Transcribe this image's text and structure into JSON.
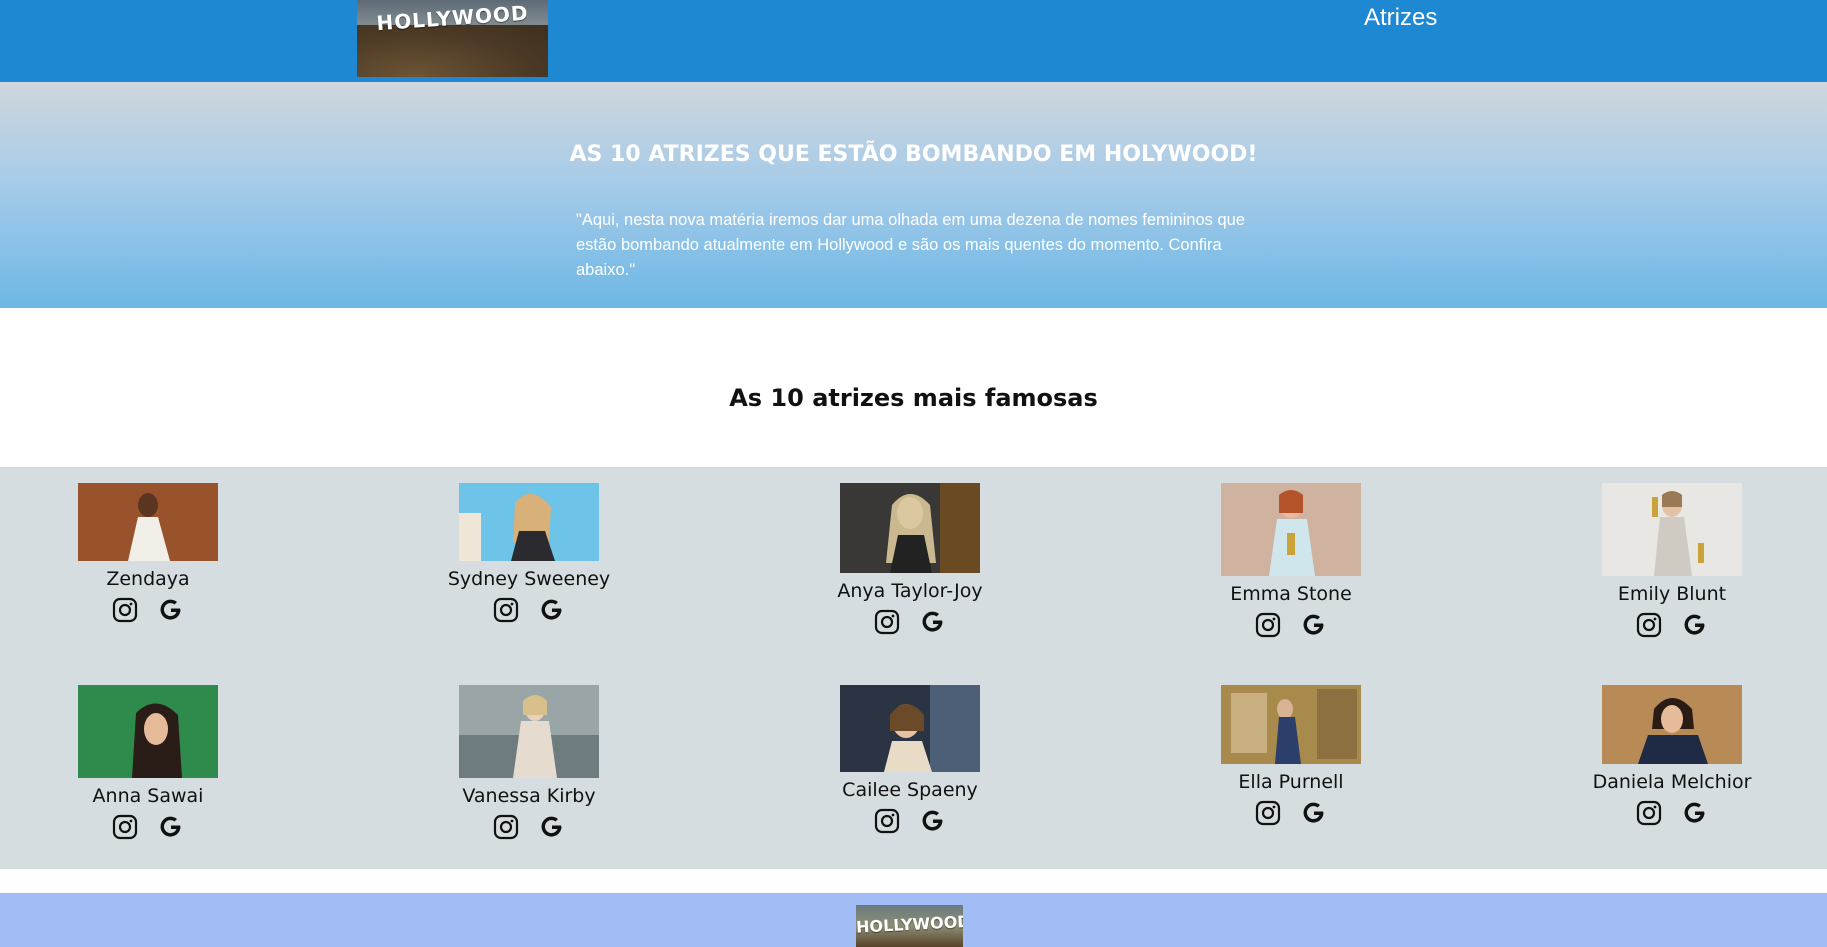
{
  "header": {
    "logo_text": "HOLLYWOOD",
    "nav_link": "Atrizes"
  },
  "hero": {
    "title": "AS 10 ATRIZES QUE ESTÃO BOMBANDO EM HOLYWOOD!",
    "quote": "\"Aqui, nesta nova matéria iremos dar uma olhada em uma dezena de nomes femininos que estão bombando atualmente em Hollywood e são os mais quentes do momento. Confira abaixo.\""
  },
  "section": {
    "title": "As 10 atrizes mais famosas"
  },
  "actresses": [
    {
      "name": "Zendaya",
      "icons": [
        "instagram-icon",
        "google-icon"
      ]
    },
    {
      "name": "Sydney Sweeney",
      "icons": [
        "instagram-icon",
        "google-icon"
      ]
    },
    {
      "name": "Anya Taylor-Joy",
      "icons": [
        "instagram-icon",
        "google-icon"
      ]
    },
    {
      "name": "Emma Stone",
      "icons": [
        "instagram-icon",
        "google-icon"
      ]
    },
    {
      "name": "Emily Blunt",
      "icons": [
        "instagram-icon",
        "google-icon"
      ]
    },
    {
      "name": "Anna Sawai",
      "icons": [
        "instagram-icon",
        "google-icon"
      ]
    },
    {
      "name": "Vanessa Kirby",
      "icons": [
        "instagram-icon",
        "google-icon"
      ]
    },
    {
      "name": "Cailee Spaeny",
      "icons": [
        "instagram-icon",
        "google-icon"
      ]
    },
    {
      "name": "Ella Purnell",
      "icons": [
        "instagram-icon",
        "google-icon"
      ]
    },
    {
      "name": "Daniela Melchior",
      "icons": [
        "instagram-icon",
        "google-icon"
      ]
    }
  ],
  "footer": {
    "logo_text": "HOLLYWOOD"
  },
  "colors": {
    "header_bg": "#1f88d3",
    "grid_bg": "#d6dde0",
    "footer_bg": "#a2bdf5"
  }
}
